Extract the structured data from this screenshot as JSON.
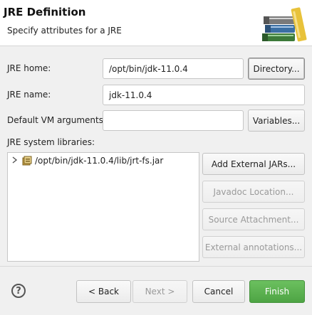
{
  "header": {
    "title": "JRE Definition",
    "subtitle": "Specify attributes for a JRE",
    "logo_icon": "jre-books-icon"
  },
  "form": {
    "jre_home_label": "JRE home:",
    "jre_home_value": "/opt/bin/jdk-11.0.4",
    "directory_button": "Directory...",
    "jre_name_label": "JRE name:",
    "jre_name_value": "jdk-11.0.4",
    "vm_args_label": "Default VM arguments:",
    "vm_args_value": "",
    "variables_button": "Variables...",
    "libraries_label": "JRE system libraries:"
  },
  "libraries": {
    "items": [
      {
        "path": "/opt/bin/jdk-11.0.4/lib/jrt-fs.jar",
        "icon": "jar-icon",
        "expanded": false
      }
    ],
    "buttons": {
      "add_external_jars": "Add External JARs...",
      "javadoc_location": "Javadoc Location...",
      "source_attachment": "Source Attachment...",
      "external_annotations": "External annotations..."
    }
  },
  "footer": {
    "help_icon": "help-icon",
    "back": "< Back",
    "next": "Next >",
    "cancel": "Cancel",
    "finish": "Finish"
  },
  "colors": {
    "finish_button": "#4ea444",
    "header_background": "#ffffff",
    "dialog_background": "#f0f0f0"
  }
}
